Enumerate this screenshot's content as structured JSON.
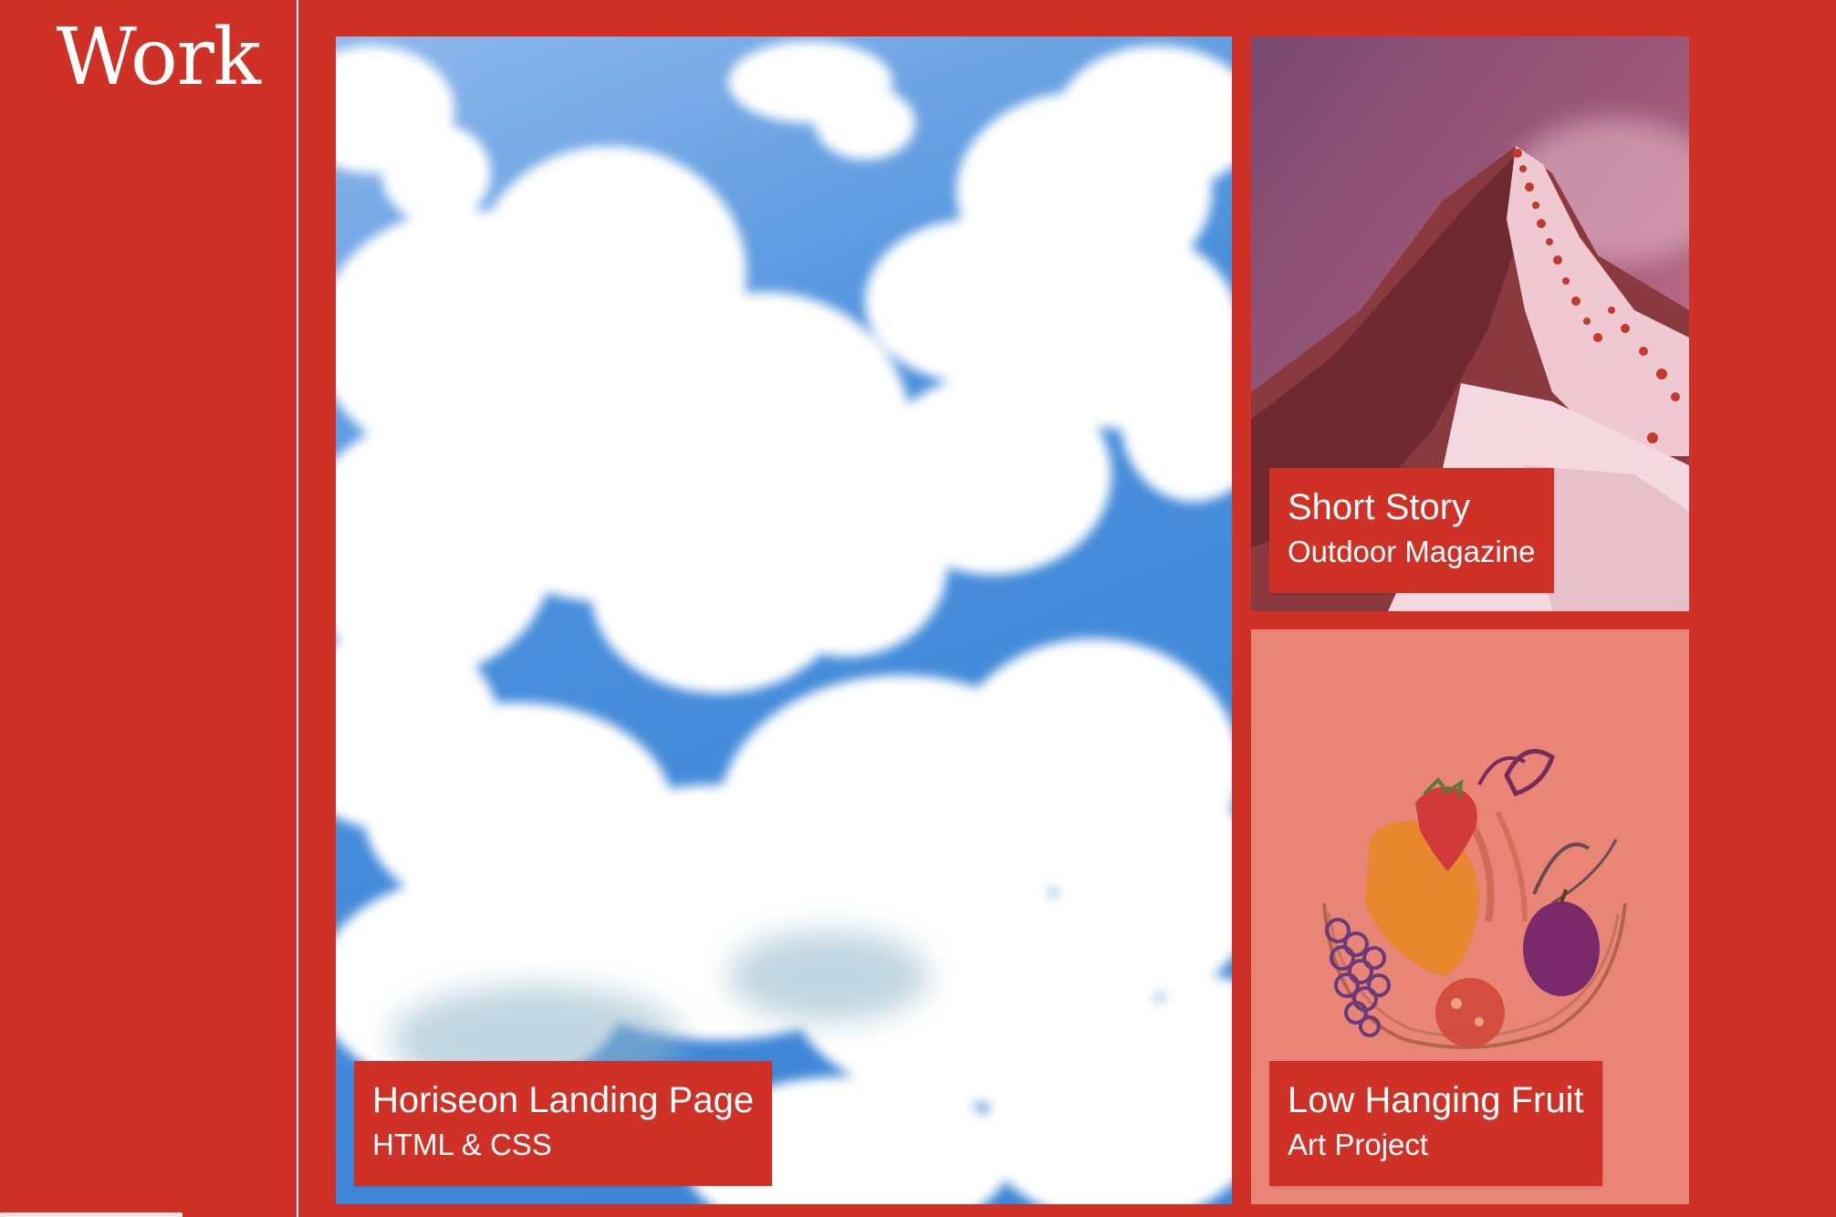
{
  "section": {
    "title": "Work"
  },
  "projects": [
    {
      "title": "Horiseon Landing Page",
      "subtitle": "HTML & CSS",
      "image": "sky-clouds-image"
    },
    {
      "title": "Short Story",
      "subtitle": "Outdoor Magazine",
      "image": "snowy-mountain-image"
    },
    {
      "title": "Low Hanging Fruit",
      "subtitle": "Art Project",
      "image": "fruit-bowl-drawing-image"
    }
  ],
  "colors": {
    "accent": "#cf3127",
    "text": "#ffffff",
    "divider": "#ffffff"
  }
}
